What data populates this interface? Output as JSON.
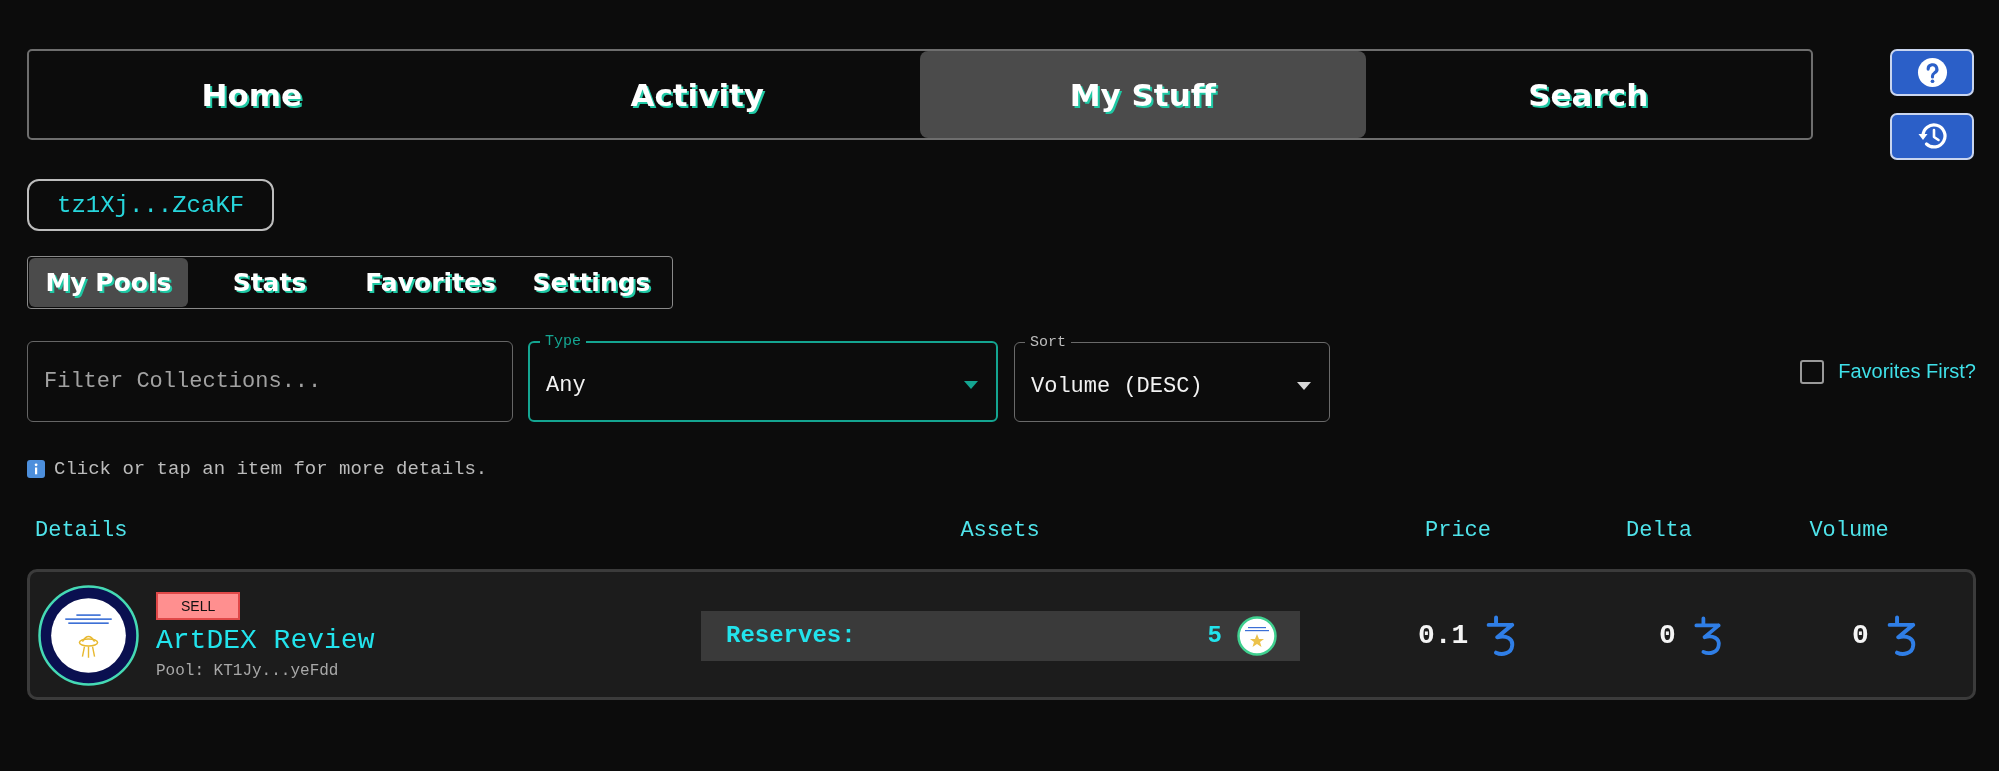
{
  "nav": {
    "tabs": [
      {
        "label": "Home",
        "selected": false
      },
      {
        "label": "Activity",
        "selected": false
      },
      {
        "label": "My Stuff",
        "selected": true
      },
      {
        "label": "Search",
        "selected": false
      }
    ]
  },
  "side_buttons": [
    {
      "kind": "help"
    },
    {
      "kind": "history"
    }
  ],
  "wallet": {
    "address": "tz1Xj...ZcaKF"
  },
  "subtabs": [
    {
      "label": "My Pools",
      "selected": true
    },
    {
      "label": "Stats",
      "selected": false
    },
    {
      "label": "Favorites",
      "selected": false
    },
    {
      "label": "Settings",
      "selected": false
    }
  ],
  "filters": {
    "search": {
      "placeholder": "Filter Collections..."
    },
    "type": {
      "label": "Type",
      "value": "Any",
      "focused": true
    },
    "sort": {
      "label": "Sort",
      "value": "Volume (DESC)",
      "focused": false
    },
    "favorites_first": {
      "label": "Favorites First?",
      "checked": false
    }
  },
  "hint": "Click or tap an item for more details.",
  "table": {
    "columns": [
      "Details",
      "Assets",
      "Price",
      "Delta",
      "Volume"
    ],
    "rows": [
      {
        "side": "SELL",
        "name": "ArtDEX Review",
        "pool": "Pool: KT1Jy...yeFdd",
        "reserves_label": "Reserves:",
        "reserves_count": "5",
        "price": "0.1",
        "delta": "0",
        "volume": "0"
      }
    ]
  }
}
